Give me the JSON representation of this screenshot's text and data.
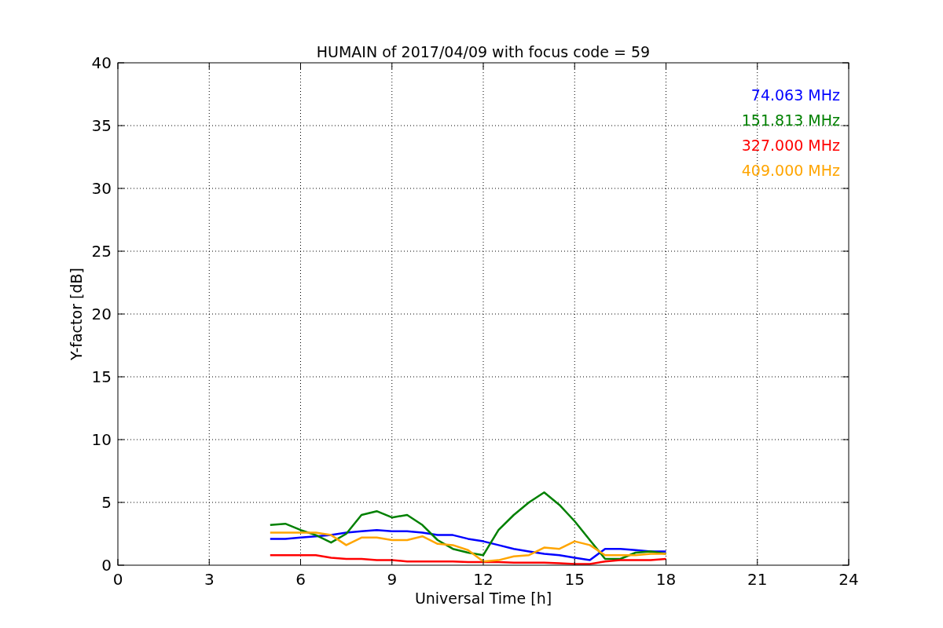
{
  "chart": {
    "chart_data": {
      "type": "line",
      "title": "HUMAIN of 2017/04/09 with focus code = 59",
      "xlabel": "Universal Time [h]",
      "ylabel": "Y-factor [dB]",
      "x": [
        5,
        5.5,
        6,
        6.5,
        7,
        7.5,
        8,
        8.5,
        9,
        9.5,
        10,
        10.5,
        11,
        11.5,
        12,
        12.5,
        13,
        13.5,
        14,
        14.5,
        15,
        15.5,
        16,
        16.5,
        17,
        17.5,
        18
      ],
      "xlim": [
        0,
        24
      ],
      "ylim": [
        0,
        40
      ],
      "xticks": [
        0,
        3,
        6,
        9,
        12,
        15,
        18,
        21,
        24
      ],
      "yticks": [
        0,
        5,
        10,
        15,
        20,
        25,
        30,
        35,
        40
      ],
      "grid": true,
      "series": [
        {
          "name": "74.063 MHz",
          "color": "#0000ff",
          "values": [
            2.1,
            2.1,
            2.2,
            2.3,
            2.4,
            2.6,
            2.7,
            2.8,
            2.7,
            2.7,
            2.6,
            2.4,
            2.4,
            2.1,
            1.9,
            1.6,
            1.3,
            1.1,
            0.9,
            0.8,
            0.6,
            0.4,
            1.3,
            1.3,
            1.2,
            1.1,
            1.1
          ]
        },
        {
          "name": "151.813 MHz",
          "color": "#008000",
          "values": [
            3.2,
            3.3,
            2.8,
            2.4,
            1.8,
            2.5,
            4.0,
            4.3,
            3.8,
            4.0,
            3.2,
            2.0,
            1.3,
            1.0,
            0.8,
            2.8,
            4.0,
            5.0,
            5.8,
            4.8,
            3.5,
            2.0,
            0.5,
            0.5,
            1.0,
            1.1,
            0.9
          ]
        },
        {
          "name": "327.000 MHz",
          "color": "#ff0000",
          "values": [
            0.8,
            0.8,
            0.8,
            0.8,
            0.6,
            0.5,
            0.5,
            0.4,
            0.4,
            0.3,
            0.3,
            0.3,
            0.3,
            0.25,
            0.25,
            0.25,
            0.2,
            0.2,
            0.2,
            0.15,
            0.1,
            0.1,
            0.3,
            0.4,
            0.4,
            0.4,
            0.5
          ]
        },
        {
          "name": "409.000 MHz",
          "color": "#ffa500",
          "values": [
            2.6,
            2.6,
            2.6,
            2.6,
            2.4,
            1.6,
            2.2,
            2.2,
            2.0,
            2.0,
            2.3,
            1.7,
            1.6,
            1.2,
            0.3,
            0.4,
            0.7,
            0.8,
            1.4,
            1.3,
            1.9,
            1.6,
            0.8,
            0.8,
            0.8,
            0.9,
            0.9
          ]
        }
      ]
    }
  }
}
